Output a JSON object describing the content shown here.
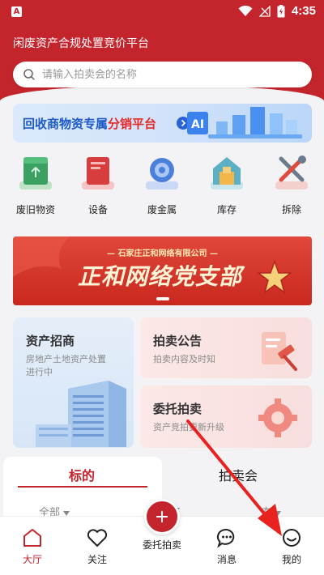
{
  "status_bar": {
    "time": "4:35",
    "app_badge": "A"
  },
  "app_title": "闲废资产合规处置竞价平台",
  "search": {
    "placeholder": "请输入拍卖会的名称"
  },
  "promo_banner": {
    "text_main": "回收商物资专属",
    "text_highlight": "分销平台"
  },
  "categories": [
    {
      "label": "废旧物资",
      "icon": "recycle-box-icon"
    },
    {
      "label": "设备",
      "icon": "equipment-icon"
    },
    {
      "label": "废金属",
      "icon": "metal-gear-icon"
    },
    {
      "label": "库存",
      "icon": "warehouse-icon"
    },
    {
      "label": "拆除",
      "icon": "tools-icon"
    }
  ],
  "party_banner": {
    "subtitle": "— 石家庄正和网络有限公司 —",
    "title": "正和网络党支部"
  },
  "cards": {
    "assets": {
      "title": "资产招商",
      "desc_line1": "房地产土地资产处置",
      "desc_line2": "进行中"
    },
    "notice": {
      "title": "拍卖公告",
      "desc": "拍卖内容及时知"
    },
    "consign": {
      "title": "委托拍卖",
      "desc": "资产竞拍更新升级"
    }
  },
  "tabs": {
    "active": "标的",
    "inactive": "拍卖会"
  },
  "filters": [
    "全部",
    "态"
  ],
  "tabbar": {
    "home": "大厅",
    "follow": "关注",
    "consign": "委托拍卖",
    "messages": "消息",
    "mine": "我的"
  },
  "colors": {
    "brand_red": "#c4242c",
    "promo_blue": "#1c59c4"
  }
}
